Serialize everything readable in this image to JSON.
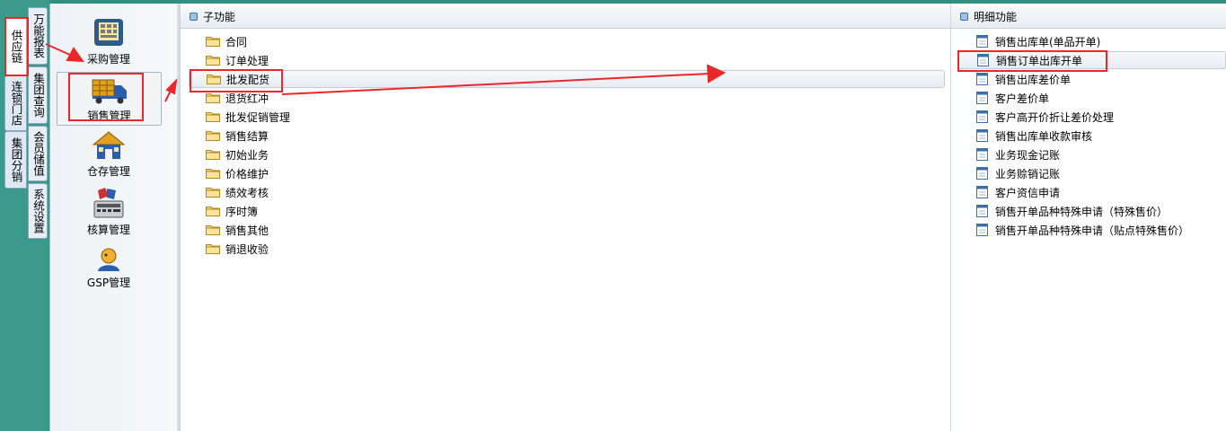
{
  "vertical_tabs_col1": [
    {
      "label": "供应链",
      "active": true
    },
    {
      "label": "连锁门店",
      "active": false
    },
    {
      "label": "集团分销",
      "active": false
    }
  ],
  "vertical_tabs_col2": [
    {
      "label": "万能报表"
    },
    {
      "label": "集团查询"
    },
    {
      "label": "会员储值"
    },
    {
      "label": "系统设置"
    }
  ],
  "modules": [
    {
      "label": "采购管理",
      "icon": "purchase-register-icon"
    },
    {
      "label": "销售管理",
      "icon": "delivery-truck-icon",
      "selected": true
    },
    {
      "label": "仓存管理",
      "icon": "warehouse-icon"
    },
    {
      "label": "核算管理",
      "icon": "accounting-calculator-icon"
    },
    {
      "label": "GSP管理",
      "icon": "gsp-person-icon"
    }
  ],
  "sub_functions": {
    "title": "子功能",
    "items": [
      "合同",
      "订单处理",
      "批发配货",
      "退货红冲",
      "批发促销管理",
      "销售结算",
      "初始业务",
      "价格维护",
      "绩效考核",
      "序时簿",
      "销售其他",
      "销退收验"
    ],
    "selected_index": 2
  },
  "detail_functions": {
    "title": "明细功能",
    "items": [
      "销售出库单(单品开单)",
      "销售订单出库开单",
      "销售出库差价单",
      "客户差价单",
      "客户高开价折让差价处理",
      "销售出库单收款审核",
      "业务现金记账",
      "业务赊销记账",
      "客户资信申请",
      "销售开单品种特殊申请（特殊售价）",
      "销售开单品种特殊申请（贴点特殊售价）"
    ],
    "selected_index": 1
  },
  "colors": {
    "frame": "#3c9a8c",
    "annotation_red": "#e8282a"
  }
}
